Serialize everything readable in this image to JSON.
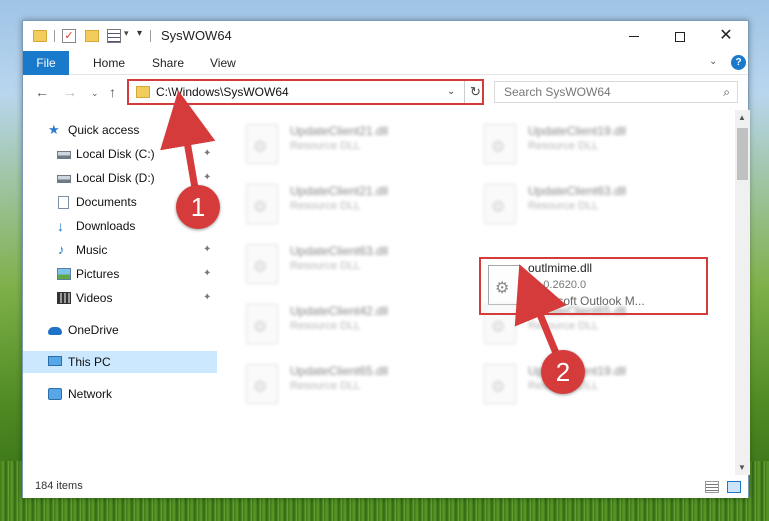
{
  "window": {
    "title": "SysWOW64",
    "minimize": "—",
    "maximize": "☐",
    "close": "✕"
  },
  "quick_access_toolbar": {
    "check_glyph": "✓",
    "dropdown_glyph": "▾",
    "customize_glyph": "▾"
  },
  "ribbon": {
    "tabs": [
      "File",
      "Home",
      "Share",
      "View"
    ],
    "expand_glyph": "⌄",
    "help_glyph": "?"
  },
  "nav": {
    "back": "←",
    "forward": "→",
    "recent": "⌄",
    "up": "↑",
    "address": "C:\\Windows\\SysWOW64",
    "address_drop": "⌄",
    "refresh": "↻",
    "search_placeholder": "Search SysWOW64",
    "search_glyph": "⌕"
  },
  "sidebar": {
    "pin_glyph": "📌",
    "items": [
      {
        "label": "Quick access",
        "icon": "star-icon",
        "glyph": "★",
        "pinned": false
      },
      {
        "label": "Local Disk (C:)",
        "icon": "disk-icon",
        "glyph": "",
        "pinned": true
      },
      {
        "label": "Local Disk (D:)",
        "icon": "disk-icon",
        "glyph": "",
        "pinned": true
      },
      {
        "label": "Documents",
        "icon": "documents-icon",
        "glyph": "",
        "pinned": true
      },
      {
        "label": "Downloads",
        "icon": "download-icon",
        "glyph": "↓",
        "pinned": true
      },
      {
        "label": "Music",
        "icon": "music-icon",
        "glyph": "♪",
        "pinned": true
      },
      {
        "label": "Pictures",
        "icon": "pictures-icon",
        "glyph": "",
        "pinned": true
      },
      {
        "label": "Videos",
        "icon": "videos-icon",
        "glyph": "",
        "pinned": true
      },
      {
        "label": "OneDrive",
        "icon": "cloud-icon",
        "glyph": "",
        "pinned": false
      },
      {
        "label": "This PC",
        "icon": "pc-icon",
        "glyph": "",
        "pinned": false,
        "selected": true
      },
      {
        "label": "Network",
        "icon": "network-icon",
        "glyph": "",
        "pinned": false
      }
    ]
  },
  "files": {
    "blurred": [
      {
        "name": "UpdateClient21.dll",
        "type": "Resource DLL"
      },
      {
        "name": "UpdateClient19.dll",
        "type": "Resource DLL"
      },
      {
        "name": "UpdateClient21.dll",
        "type": "Resource DLL"
      },
      {
        "name": "UpdateClient63.dll",
        "type": "Resource DLL"
      },
      {
        "name": "UpdateClient63.dll",
        "type": "Resource DLL"
      },
      {
        "name": "UpdateClient42.dll",
        "type": "Resource DLL"
      },
      {
        "name": "UpdateClient65.dll",
        "type": "Resource DLL"
      },
      {
        "name": "UpdateClient65.dll",
        "type": "Resource DLL"
      },
      {
        "name": "UpdateClient19.dll",
        "type": "Resource DLL"
      }
    ],
    "focused": {
      "name": "outlmime.dll",
      "version": "10.0.2620.0",
      "description": "Microsoft Outlook M..."
    }
  },
  "status": {
    "item_count": "184 items"
  },
  "callouts": [
    "1",
    "2"
  ],
  "colors": {
    "accent": "#1979ca",
    "callout": "#d63b3b",
    "highlight": "#d43b3b",
    "selection": "#cce8ff"
  }
}
